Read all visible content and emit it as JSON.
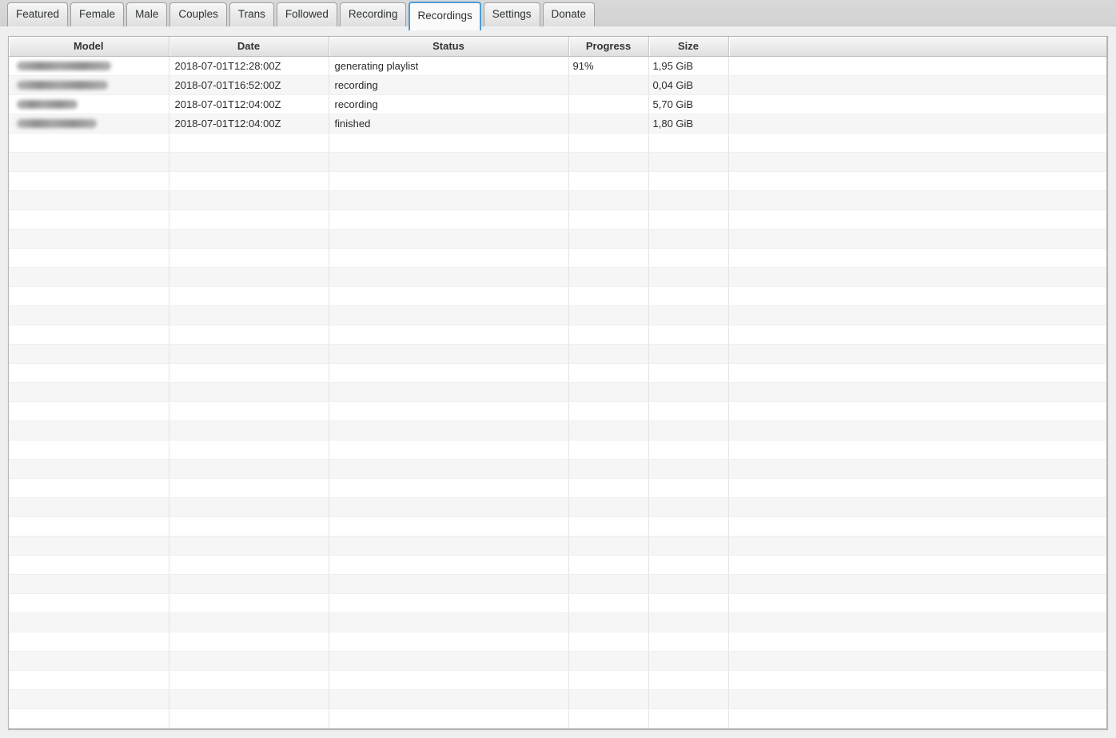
{
  "tabs": {
    "items": [
      {
        "label": "Featured",
        "active": false
      },
      {
        "label": "Female",
        "active": false
      },
      {
        "label": "Male",
        "active": false
      },
      {
        "label": "Couples",
        "active": false
      },
      {
        "label": "Trans",
        "active": false
      },
      {
        "label": "Followed",
        "active": false
      },
      {
        "label": "Recording",
        "active": false
      },
      {
        "label": "Recordings",
        "active": true
      },
      {
        "label": "Settings",
        "active": false
      },
      {
        "label": "Donate",
        "active": false
      }
    ]
  },
  "table": {
    "columns": [
      "Model",
      "Date",
      "Status",
      "Progress",
      "Size",
      ""
    ],
    "rows": [
      {
        "model_redacted": true,
        "model_blur_width": 118,
        "date": "2018-07-01T12:28:00Z",
        "status": "generating playlist",
        "progress": "91%",
        "size": "1,95 GiB"
      },
      {
        "model_redacted": true,
        "model_blur_width": 114,
        "date": "2018-07-01T16:52:00Z",
        "status": "recording",
        "progress": "",
        "size": "0,04 GiB"
      },
      {
        "model_redacted": true,
        "model_blur_width": 76,
        "date": "2018-07-01T12:04:00Z",
        "status": "recording",
        "progress": "",
        "size": "5,70 GiB"
      },
      {
        "model_redacted": true,
        "model_blur_width": 100,
        "date": "2018-07-01T12:04:00Z",
        "status": "finished",
        "progress": "",
        "size": "1,80 GiB"
      }
    ],
    "empty_row_count": 31
  },
  "colors": {
    "accent": "#4f9cd8",
    "strip_background": "#d6d6d6",
    "page_background": "#efefef",
    "zebra_row": "#f6f6f6"
  }
}
